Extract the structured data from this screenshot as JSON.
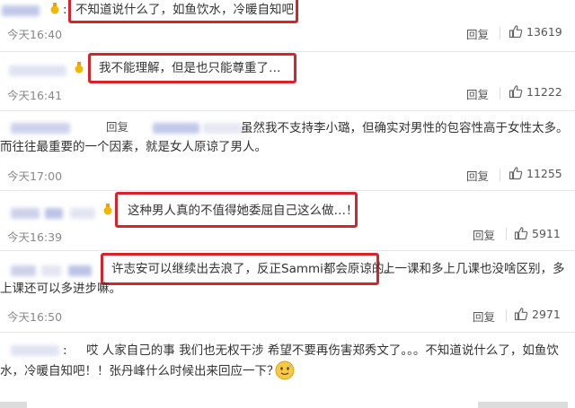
{
  "comments": [
    {
      "text": "不知道说什么了，如鱼饮水，冷暖自知吧",
      "colon": ":",
      "time": "今天16:40",
      "reply": "回复",
      "likes": "13619"
    },
    {
      "text": "我不能理解，但是也只能尊重了…",
      "time": "今天16:41",
      "reply": "回复",
      "likes": "11222"
    },
    {
      "reply_prefix": "回复",
      "text_line1": "虽然我不支持李小璐，但确实对男性的包容性高于女性太多。",
      "text_line2": "而往往最重要的一个因素，就是女人原谅了男人。",
      "time": "今天17:00",
      "reply": "回复",
      "likes": "11255"
    },
    {
      "text": "这种男人真的不值得她委屈自己这么做…！",
      "time": "今天16:39",
      "reply": "回复",
      "likes": "5911"
    },
    {
      "text_highlight": "许志安可以继续出去浪了，反正Sammi都会原谅的。",
      "text_rest": "上一课和多上几课也没啥区别，多",
      "text_line2": "上课还可以多进步嘛。",
      "time": "今天16:50",
      "reply": "回复",
      "likes": "2971"
    },
    {
      "colon": ":",
      "text_line1": "哎 人家自己的事 我们也无权干涉 希望不要再伤害郑秀文了。。。不知道说什么了，如鱼饮",
      "text_line2": "水，冷暖自知吧！！张丹峰什么时候出来回应一下？"
    }
  ],
  "icons": {
    "like": "thumbs-up-icon",
    "emoji": "sweat-smile-icon"
  },
  "colors": {
    "highlight": "#d9232a",
    "time": "#888888"
  }
}
